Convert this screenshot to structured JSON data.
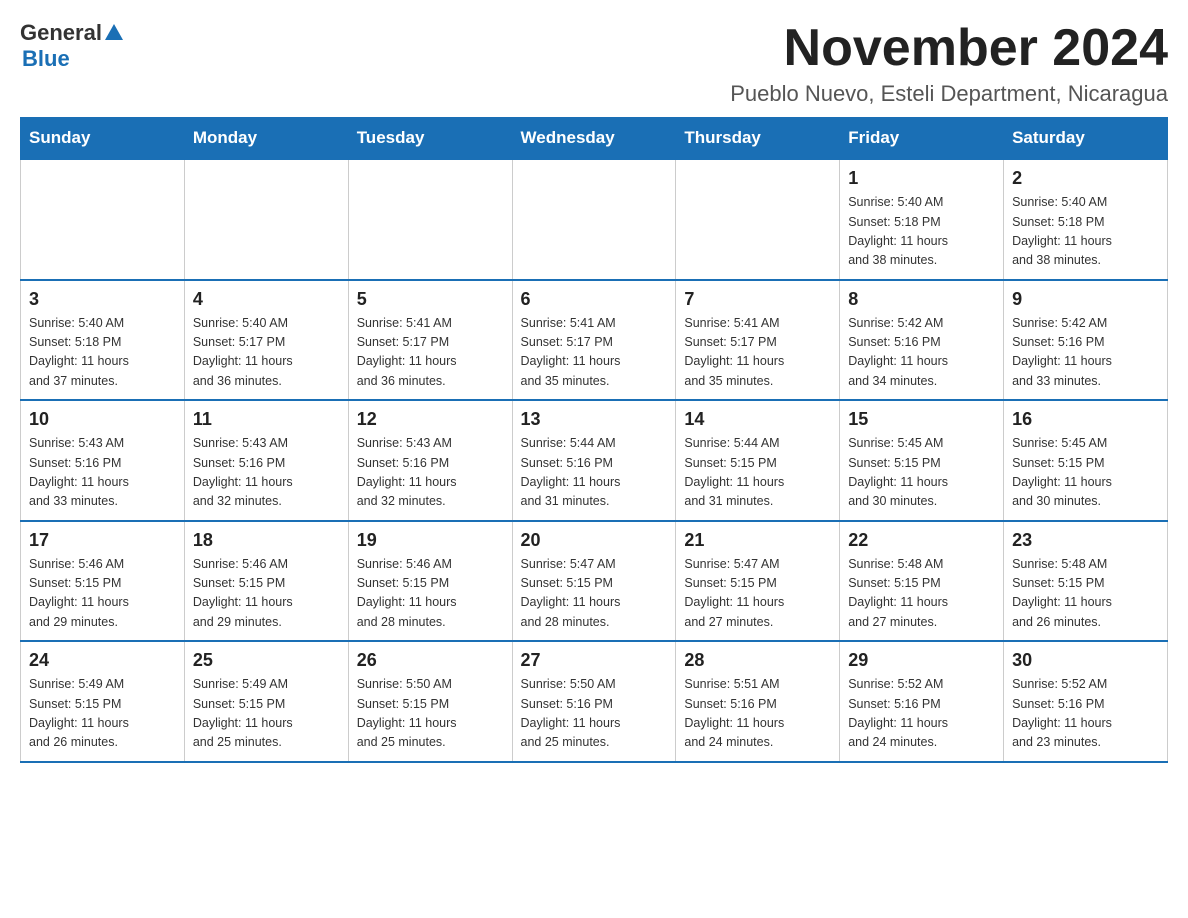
{
  "logo": {
    "general": "General",
    "blue": "Blue"
  },
  "header": {
    "month_title": "November 2024",
    "location": "Pueblo Nuevo, Esteli Department, Nicaragua"
  },
  "days_of_week": [
    "Sunday",
    "Monday",
    "Tuesday",
    "Wednesday",
    "Thursday",
    "Friday",
    "Saturday"
  ],
  "weeks": [
    [
      {
        "day": "",
        "info": ""
      },
      {
        "day": "",
        "info": ""
      },
      {
        "day": "",
        "info": ""
      },
      {
        "day": "",
        "info": ""
      },
      {
        "day": "",
        "info": ""
      },
      {
        "day": "1",
        "info": "Sunrise: 5:40 AM\nSunset: 5:18 PM\nDaylight: 11 hours\nand 38 minutes."
      },
      {
        "day": "2",
        "info": "Sunrise: 5:40 AM\nSunset: 5:18 PM\nDaylight: 11 hours\nand 38 minutes."
      }
    ],
    [
      {
        "day": "3",
        "info": "Sunrise: 5:40 AM\nSunset: 5:18 PM\nDaylight: 11 hours\nand 37 minutes."
      },
      {
        "day": "4",
        "info": "Sunrise: 5:40 AM\nSunset: 5:17 PM\nDaylight: 11 hours\nand 36 minutes."
      },
      {
        "day": "5",
        "info": "Sunrise: 5:41 AM\nSunset: 5:17 PM\nDaylight: 11 hours\nand 36 minutes."
      },
      {
        "day": "6",
        "info": "Sunrise: 5:41 AM\nSunset: 5:17 PM\nDaylight: 11 hours\nand 35 minutes."
      },
      {
        "day": "7",
        "info": "Sunrise: 5:41 AM\nSunset: 5:17 PM\nDaylight: 11 hours\nand 35 minutes."
      },
      {
        "day": "8",
        "info": "Sunrise: 5:42 AM\nSunset: 5:16 PM\nDaylight: 11 hours\nand 34 minutes."
      },
      {
        "day": "9",
        "info": "Sunrise: 5:42 AM\nSunset: 5:16 PM\nDaylight: 11 hours\nand 33 minutes."
      }
    ],
    [
      {
        "day": "10",
        "info": "Sunrise: 5:43 AM\nSunset: 5:16 PM\nDaylight: 11 hours\nand 33 minutes."
      },
      {
        "day": "11",
        "info": "Sunrise: 5:43 AM\nSunset: 5:16 PM\nDaylight: 11 hours\nand 32 minutes."
      },
      {
        "day": "12",
        "info": "Sunrise: 5:43 AM\nSunset: 5:16 PM\nDaylight: 11 hours\nand 32 minutes."
      },
      {
        "day": "13",
        "info": "Sunrise: 5:44 AM\nSunset: 5:16 PM\nDaylight: 11 hours\nand 31 minutes."
      },
      {
        "day": "14",
        "info": "Sunrise: 5:44 AM\nSunset: 5:15 PM\nDaylight: 11 hours\nand 31 minutes."
      },
      {
        "day": "15",
        "info": "Sunrise: 5:45 AM\nSunset: 5:15 PM\nDaylight: 11 hours\nand 30 minutes."
      },
      {
        "day": "16",
        "info": "Sunrise: 5:45 AM\nSunset: 5:15 PM\nDaylight: 11 hours\nand 30 minutes."
      }
    ],
    [
      {
        "day": "17",
        "info": "Sunrise: 5:46 AM\nSunset: 5:15 PM\nDaylight: 11 hours\nand 29 minutes."
      },
      {
        "day": "18",
        "info": "Sunrise: 5:46 AM\nSunset: 5:15 PM\nDaylight: 11 hours\nand 29 minutes."
      },
      {
        "day": "19",
        "info": "Sunrise: 5:46 AM\nSunset: 5:15 PM\nDaylight: 11 hours\nand 28 minutes."
      },
      {
        "day": "20",
        "info": "Sunrise: 5:47 AM\nSunset: 5:15 PM\nDaylight: 11 hours\nand 28 minutes."
      },
      {
        "day": "21",
        "info": "Sunrise: 5:47 AM\nSunset: 5:15 PM\nDaylight: 11 hours\nand 27 minutes."
      },
      {
        "day": "22",
        "info": "Sunrise: 5:48 AM\nSunset: 5:15 PM\nDaylight: 11 hours\nand 27 minutes."
      },
      {
        "day": "23",
        "info": "Sunrise: 5:48 AM\nSunset: 5:15 PM\nDaylight: 11 hours\nand 26 minutes."
      }
    ],
    [
      {
        "day": "24",
        "info": "Sunrise: 5:49 AM\nSunset: 5:15 PM\nDaylight: 11 hours\nand 26 minutes."
      },
      {
        "day": "25",
        "info": "Sunrise: 5:49 AM\nSunset: 5:15 PM\nDaylight: 11 hours\nand 25 minutes."
      },
      {
        "day": "26",
        "info": "Sunrise: 5:50 AM\nSunset: 5:15 PM\nDaylight: 11 hours\nand 25 minutes."
      },
      {
        "day": "27",
        "info": "Sunrise: 5:50 AM\nSunset: 5:16 PM\nDaylight: 11 hours\nand 25 minutes."
      },
      {
        "day": "28",
        "info": "Sunrise: 5:51 AM\nSunset: 5:16 PM\nDaylight: 11 hours\nand 24 minutes."
      },
      {
        "day": "29",
        "info": "Sunrise: 5:52 AM\nSunset: 5:16 PM\nDaylight: 11 hours\nand 24 minutes."
      },
      {
        "day": "30",
        "info": "Sunrise: 5:52 AM\nSunset: 5:16 PM\nDaylight: 11 hours\nand 23 minutes."
      }
    ]
  ]
}
